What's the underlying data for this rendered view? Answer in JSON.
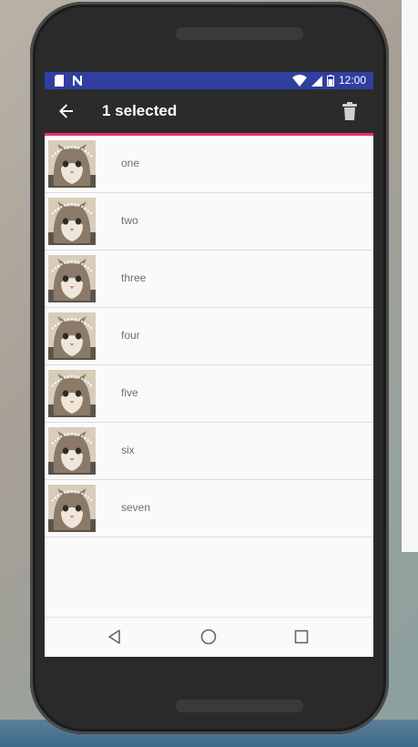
{
  "status_bar": {
    "time": "12:00",
    "left_icons": [
      "sd-card-icon",
      "notification-n-icon"
    ],
    "right_icons": [
      "wifi-icon",
      "cell-signal-icon",
      "battery-icon"
    ]
  },
  "app_bar": {
    "title": "1 selected",
    "back_icon": "arrow-back-icon",
    "action_icon": "trash-icon",
    "accent_color": "#e8336b",
    "background_color": "#2b2b2b"
  },
  "list": {
    "items": [
      {
        "label": "one"
      },
      {
        "label": "two"
      },
      {
        "label": "three"
      },
      {
        "label": "four"
      },
      {
        "label": "five"
      },
      {
        "label": "six"
      },
      {
        "label": "seven"
      }
    ]
  },
  "nav_bar": {
    "buttons": [
      "back-triangle-icon",
      "home-circle-icon",
      "recents-square-icon"
    ]
  }
}
